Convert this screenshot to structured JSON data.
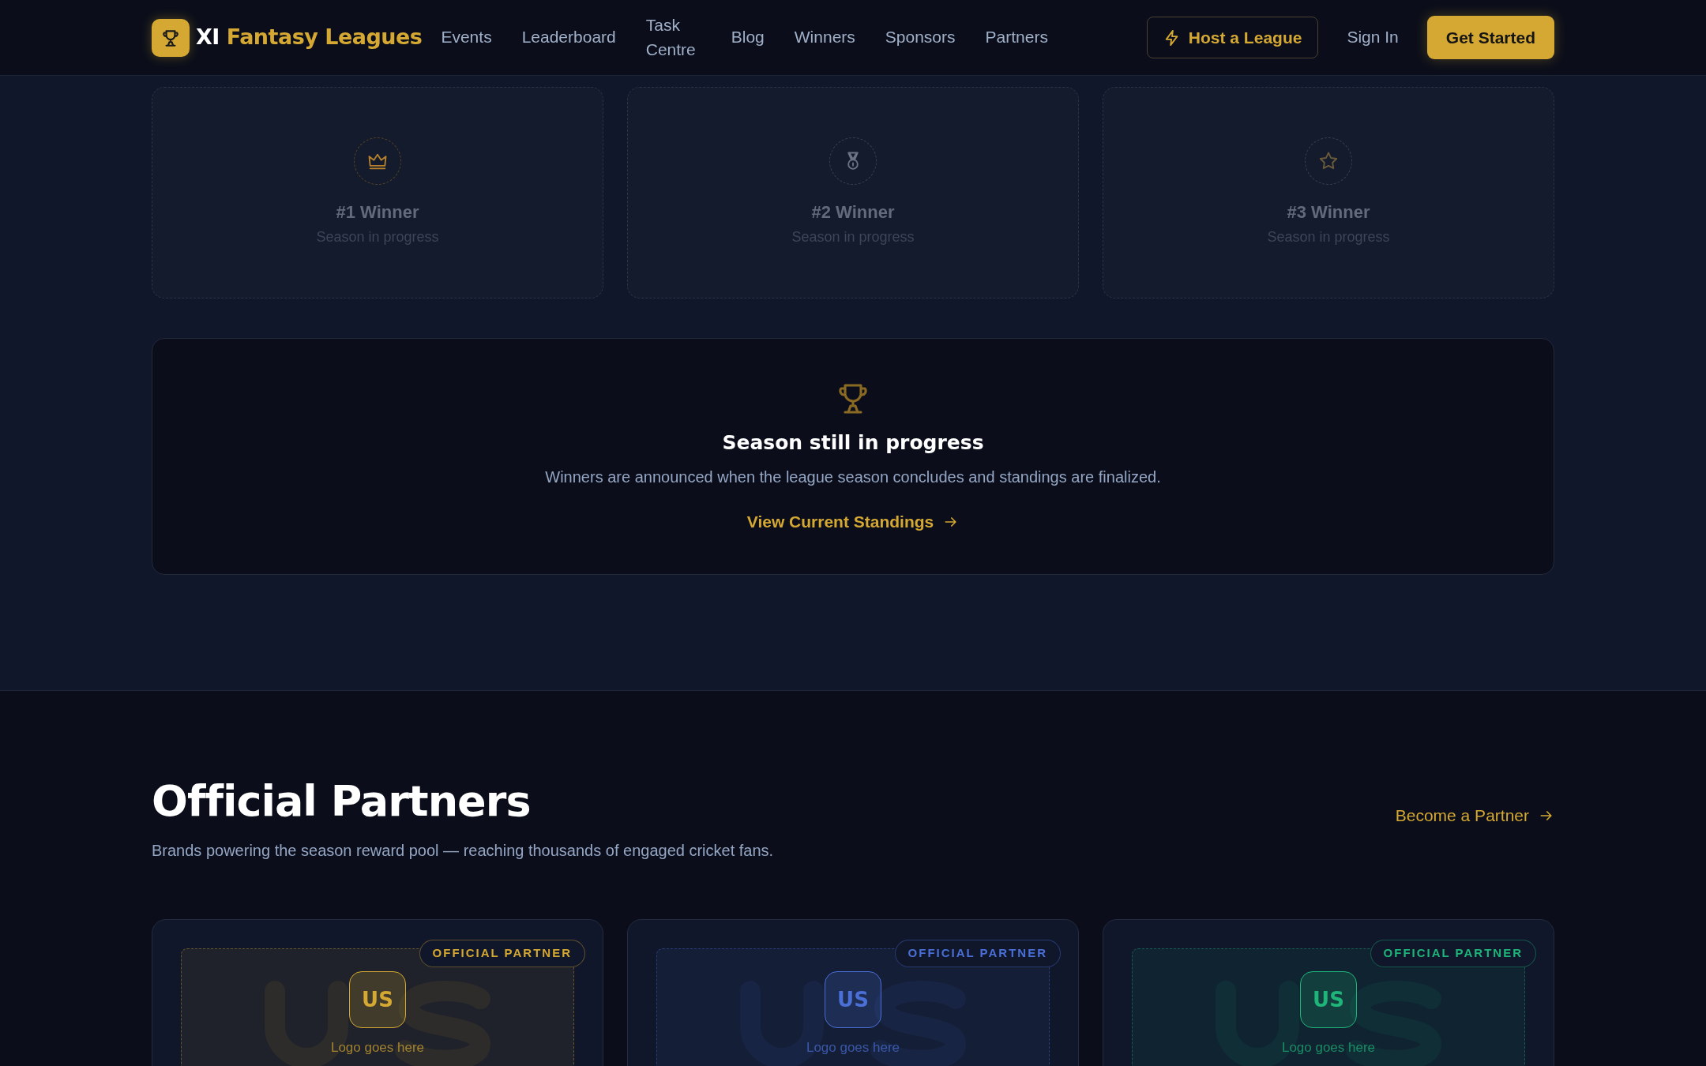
{
  "navbar": {
    "brand_prefix": "XI",
    "brand_accent": "Fantasy Leagues",
    "links": [
      {
        "label": "Events"
      },
      {
        "label": "Leaderboard"
      },
      {
        "label": "Task Centre"
      },
      {
        "label": "Blog"
      },
      {
        "label": "Winners"
      },
      {
        "label": "Sponsors"
      },
      {
        "label": "Partners"
      }
    ],
    "host_button": "Host a League",
    "sign_in": "Sign In",
    "cta": "Get Started"
  },
  "winners": [
    {
      "kind": "crown",
      "title": "#1 Winner",
      "status": "Season in progress"
    },
    {
      "kind": "medal",
      "title": "#2 Winner",
      "status": "Season in progress"
    },
    {
      "kind": "star",
      "title": "#3 Winner",
      "status": "Season in progress"
    }
  ],
  "season_panel": {
    "title": "Season still in progress",
    "text": "Winners are announced when the league season concludes and standings are finalized.",
    "link": "View Current Standings"
  },
  "partners": {
    "heading": "Official Partners",
    "subtitle": "Brands powering the season reward pool — reaching thousands of engaged cricket fans.",
    "link": "Become a Partner",
    "cards": [
      {
        "badge": "OFFICIAL PARTNER",
        "initials": "US",
        "caption": "Logo goes here",
        "color": "#d4a832"
      },
      {
        "badge": "OFFICIAL PARTNER",
        "initials": "US",
        "caption": "Logo goes here",
        "color": "#4a6fd6"
      },
      {
        "badge": "OFFICIAL PARTNER",
        "initials": "US",
        "caption": "Logo goes here",
        "color": "#1fb57a"
      }
    ]
  }
}
